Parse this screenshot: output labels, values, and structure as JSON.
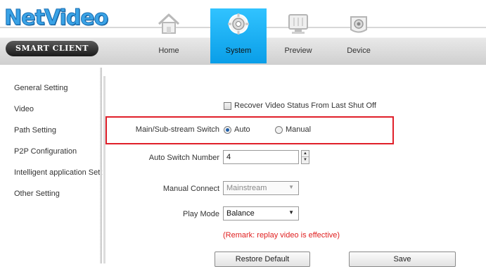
{
  "app": {
    "logo_text": "NetVideo",
    "subtitle": "SMART CLIENT"
  },
  "nav": {
    "tabs": [
      {
        "label": "Home",
        "icon": "home-icon",
        "active": false
      },
      {
        "label": "System",
        "icon": "gear-icon",
        "active": true
      },
      {
        "label": "Preview",
        "icon": "monitor-icon",
        "active": false
      },
      {
        "label": "Device",
        "icon": "camera-icon",
        "active": false
      }
    ]
  },
  "sidebar": {
    "items": [
      {
        "label": "General Setting"
      },
      {
        "label": "Video"
      },
      {
        "label": "Path Setting"
      },
      {
        "label": "P2P Configuration"
      },
      {
        "label": "Intelligent application Sett"
      },
      {
        "label": "Other Setting"
      }
    ]
  },
  "video": {
    "recover_label": "Recover Video Status From Last Shut Off",
    "recover_checked": false,
    "stream_switch_label": "Main/Sub-stream Switch",
    "stream_switch_options": [
      {
        "label": "Auto",
        "checked": true
      },
      {
        "label": "Manual",
        "checked": false
      }
    ],
    "auto_switch_label": "Auto Switch Number",
    "auto_switch_value": "4",
    "manual_connect_label": "Manual Connect",
    "manual_connect_value": "Mainstream",
    "play_mode_label": "Play Mode",
    "play_mode_value": "Balance",
    "remark": "(Remark: replay video is effective)",
    "restore_label": "Restore Default",
    "save_label": "Save"
  },
  "colors": {
    "accent": "#0a9ee8",
    "highlight_border": "#e0202a",
    "remark_text": "#e02020"
  }
}
